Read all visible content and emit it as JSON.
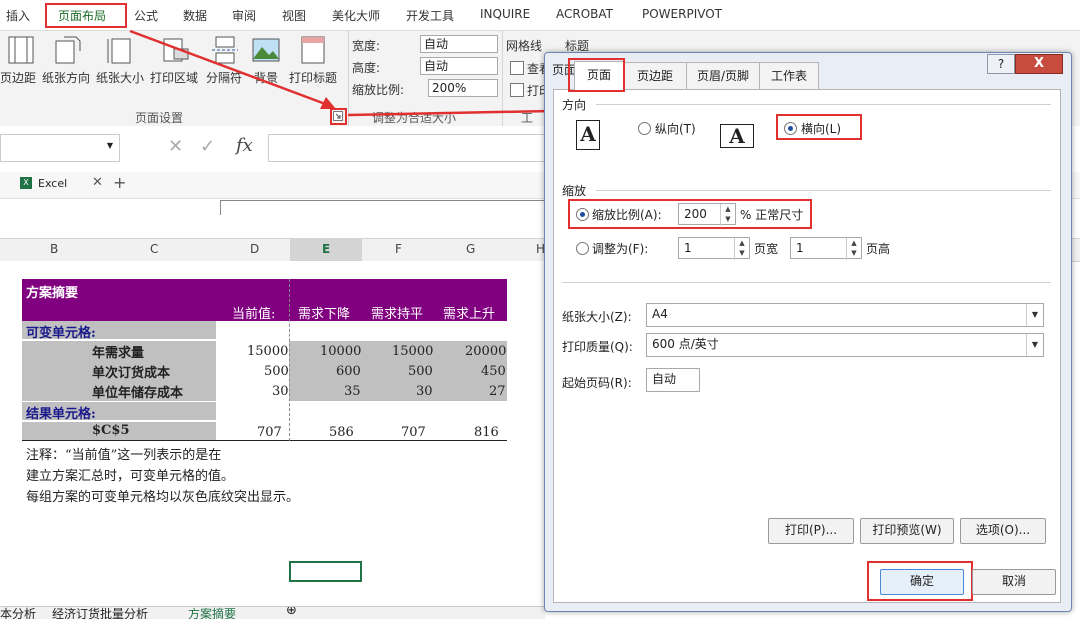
{
  "ribbon_tabs": [
    "插入",
    "页面布局",
    "公式",
    "数据",
    "审阅",
    "视图",
    "美化大师",
    "开发工具",
    "INQUIRE",
    "ACROBAT",
    "POWERPIVOT"
  ],
  "ribbon": {
    "buttons": [
      "页边距",
      "纸张方向",
      "纸张大小",
      "打印区域",
      "分隔符",
      "背景",
      "打印标题"
    ],
    "group_page_setup": "页面设置",
    "width_label": "宽度:",
    "width_value": "自动",
    "height_label": "高度:",
    "height_value": "自动",
    "scale_label": "缩放比例:",
    "scale_value": "200%",
    "group_scale": "调整为合适大小",
    "gridlines": "网格线",
    "headings": "标题",
    "view_trunc": "查看",
    "print_trunc": "打印",
    "group_sheet_trunc": "工"
  },
  "formula_bar": {
    "fx": "fx"
  },
  "workbook_tab": "Excel",
  "columns": [
    "B",
    "C",
    "D",
    "E",
    "F",
    "G",
    "H"
  ],
  "table": {
    "title": "方案摘要",
    "headers": [
      "当前值:",
      "需求下降",
      "需求持平",
      "需求上升"
    ],
    "changing_label": "可变单元格:",
    "rows": [
      {
        "label": "年需求量",
        "values": [
          "15000",
          "10000",
          "15000",
          "20000"
        ]
      },
      {
        "label": "单次订货成本",
        "values": [
          "500",
          "600",
          "500",
          "450"
        ]
      },
      {
        "label": "单位年储存成本",
        "values": [
          "30",
          "35",
          "30",
          "27"
        ]
      }
    ],
    "result_label": "结果单元格:",
    "result_row": {
      "label": "$C$5",
      "values": [
        "707",
        "586",
        "707",
        "816"
      ]
    },
    "notes": [
      "注释：“当前值”这一列表示的是在",
      "建立方案汇总时，可变单元格的值。",
      "每组方案的可变单元格均以灰色底纹突出显示。"
    ]
  },
  "sheet_tabs": [
    "本分析",
    "经济订货批量分析",
    "方案摘要"
  ],
  "dialog": {
    "title": "页面设置",
    "help": "?",
    "close": "X",
    "tabs": [
      "页面",
      "页边距",
      "页眉/页脚",
      "工作表"
    ],
    "orientation_section": "方向",
    "portrait": "纵向(T)",
    "landscape": "横向(L)",
    "scaling_section": "缩放",
    "adjust_ratio_label": "缩放比例(A):",
    "adjust_ratio_value": "200",
    "adjust_ratio_suffix": "% 正常尺寸",
    "fit_to_label": "调整为(F):",
    "fit_wide_value": "1",
    "fit_wide_suffix": "页宽",
    "fit_tall_value": "1",
    "fit_tall_suffix": "页高",
    "paper_size_label": "纸张大小(Z):",
    "paper_size_value": "A4",
    "print_quality_label": "打印质量(Q):",
    "print_quality_value": "600 点/英寸",
    "first_page_label": "起始页码(R):",
    "first_page_value": "自动",
    "print_btn": "打印(P)...",
    "preview_btn": "打印预览(W)",
    "options_btn": "选项(O)...",
    "ok_btn": "确定",
    "cancel_btn": "取消"
  },
  "colors": {
    "accent_red": "#e03030",
    "purple": "#800080",
    "gray": "#c0c0c0"
  }
}
